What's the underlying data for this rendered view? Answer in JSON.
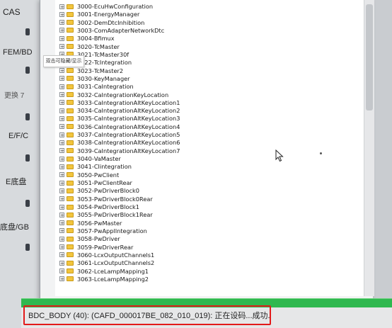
{
  "sidebar": {
    "labels": [
      "CAS",
      "FEM/BD",
      "更换 7",
      "E/F/C",
      "E底盘",
      "底盘/GB"
    ]
  },
  "tooltip": "双击可隐藏/显示",
  "tree": {
    "items": [
      {
        "code": "3000",
        "name": "EcuHwConfiguration"
      },
      {
        "code": "3001",
        "name": "EnergyManager"
      },
      {
        "code": "3002",
        "name": "DemDtcInhibition"
      },
      {
        "code": "3003",
        "name": "ComAdapterNetworkDtc"
      },
      {
        "code": "3004",
        "name": "Bfimux"
      },
      {
        "code": "3020",
        "name": "TcMaster"
      },
      {
        "code": "3021",
        "name": "TcMaster30f"
      },
      {
        "code": "3022",
        "name": "TcIntegration"
      },
      {
        "code": "3023",
        "name": "TcMaster2"
      },
      {
        "code": "3030",
        "name": "KeyManager"
      },
      {
        "code": "3031",
        "name": "CaIntegration"
      },
      {
        "code": "3032",
        "name": "CaIntegrationKeyLocation"
      },
      {
        "code": "3033",
        "name": "CaIntegrationAltKeyLocation1"
      },
      {
        "code": "3034",
        "name": "CaIntegrationAltKeyLocation2"
      },
      {
        "code": "3035",
        "name": "CaIntegrationAltKeyLocation3"
      },
      {
        "code": "3036",
        "name": "CaIntegrationAltKeyLocation4"
      },
      {
        "code": "3037",
        "name": "CaIntegrationAltKeyLocation5"
      },
      {
        "code": "3038",
        "name": "CaIntegrationAltKeyLocation6"
      },
      {
        "code": "3039",
        "name": "CaIntegrationAltKeyLocation7"
      },
      {
        "code": "3040",
        "name": "VaMaster"
      },
      {
        "code": "3041",
        "name": "CIintegration"
      },
      {
        "code": "3050",
        "name": "PwClient"
      },
      {
        "code": "3051",
        "name": "PwClientRear"
      },
      {
        "code": "3052",
        "name": "PwDriverBlock0"
      },
      {
        "code": "3053",
        "name": "PwDriverBlock0Rear"
      },
      {
        "code": "3054",
        "name": "PwDriverBlock1"
      },
      {
        "code": "3055",
        "name": "PwDriverBlock1Rear"
      },
      {
        "code": "3056",
        "name": "PwMaster"
      },
      {
        "code": "3057",
        "name": "PwApplIntegration"
      },
      {
        "code": "3058",
        "name": "PwDriver"
      },
      {
        "code": "3059",
        "name": "PwDriverRear"
      },
      {
        "code": "3060",
        "name": "LcxOutputChannels1"
      },
      {
        "code": "3061",
        "name": "LcxOutputChannels2"
      },
      {
        "code": "3062",
        "name": "LceLampMapping1"
      },
      {
        "code": "3063",
        "name": "LceLampMapping2"
      }
    ]
  },
  "status": {
    "text": "BDC_BODY (40): (CAFD_000017BE_082_010_019): 正在设码...成功.",
    "progress": 1.0
  },
  "colors": {
    "progress": "#2fb84f",
    "highlight_border": "#e21a1a",
    "folder": "#f2c53d"
  }
}
